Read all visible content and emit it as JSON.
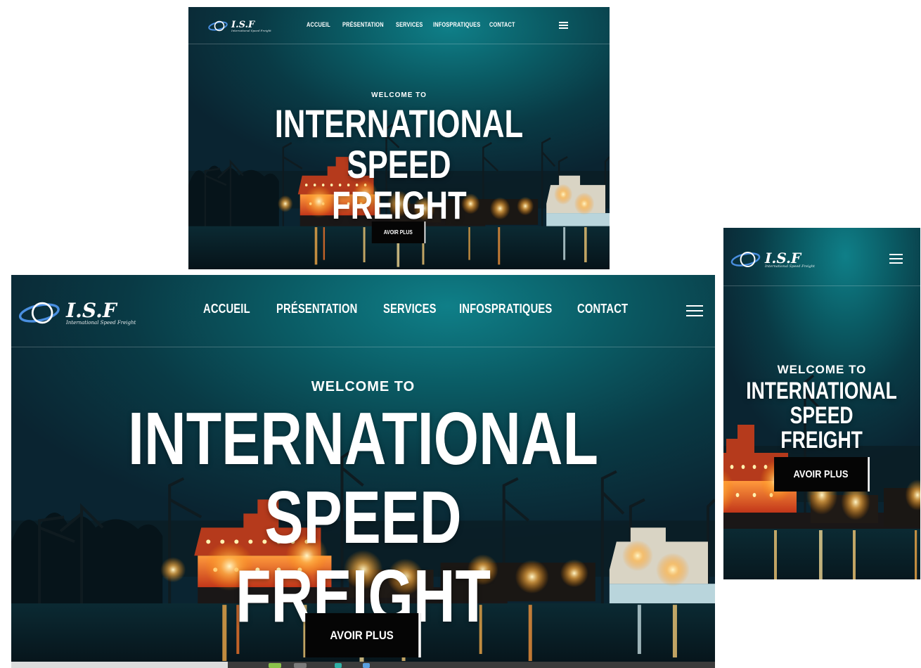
{
  "brand": {
    "logo_text": "I.S.F",
    "logo_subtitle": "International Speed Freight"
  },
  "nav": {
    "items": [
      {
        "label": "ACCUEIL"
      },
      {
        "label": "PRÉSENTATION"
      },
      {
        "label": "SERVICES"
      },
      {
        "label": "INFOSPRATIQUES"
      },
      {
        "label": "CONTACT"
      }
    ]
  },
  "hero": {
    "welcome": "WELCOME TO",
    "title_line1": "INTERNATIONAL SPEED",
    "title_line2": "FREIGHT",
    "mobile_title_line1": "INTERNATIONAL",
    "mobile_title_line2": "SPEED",
    "mobile_title_line3": "FREIGHT",
    "cta_label": "AVOIR PLUS"
  },
  "icons": {
    "menu": "hamburger-menu-icon",
    "logo_orbit": "orbit-swoosh-icon"
  },
  "colors": {
    "teal_dark": "#0a2431",
    "teal_mid": "#0a5a63",
    "teal_light": "#0f7f88",
    "button_bg": "#050505",
    "text": "#ffffff",
    "logo_accent": "#4a8fe0"
  }
}
